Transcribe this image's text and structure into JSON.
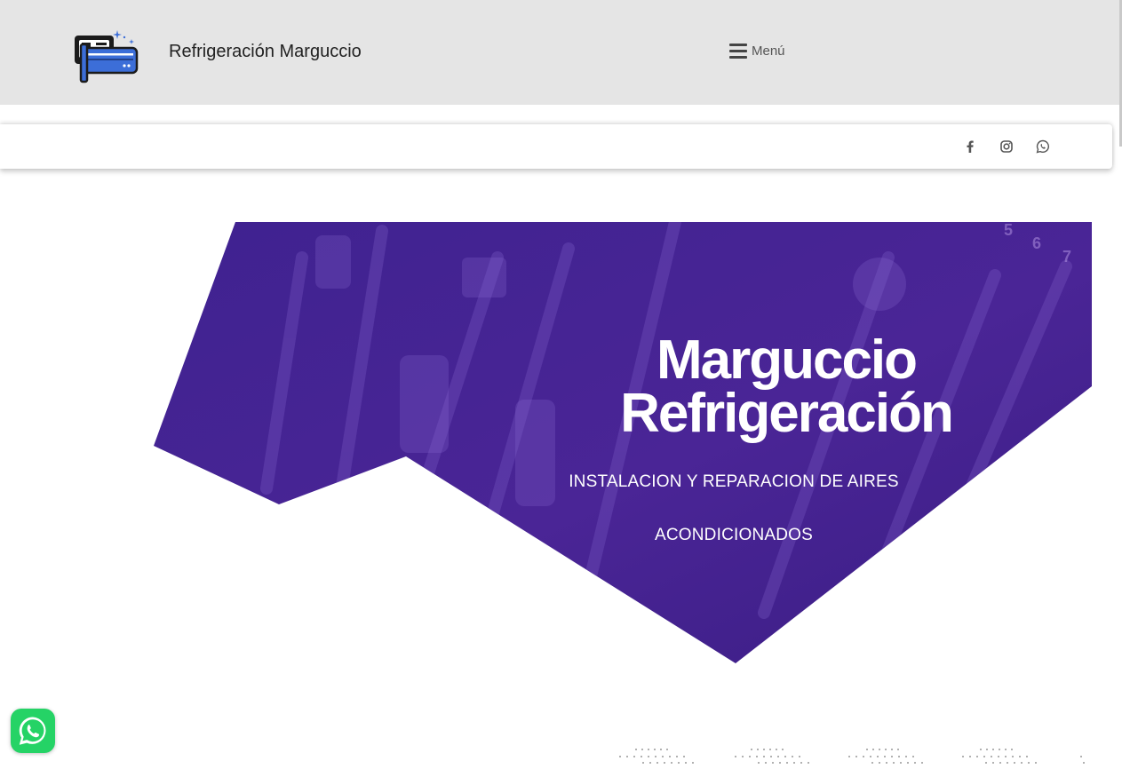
{
  "header": {
    "site_title": "Refrigeración Marguccio",
    "logo_icon": "air-conditioner-icon",
    "menu_label": "Menú",
    "menu_icon": "hamburger-icon"
  },
  "social": {
    "facebook_icon": "facebook-icon",
    "instagram_icon": "instagram-icon",
    "whatsapp_icon": "whatsapp-icon"
  },
  "hero": {
    "title_line1": "Marguccio",
    "title_line2": "Refrigeración",
    "subtitle": "INSTALACION Y REPARACION DE AIRES ACONDICIONADOS"
  },
  "floating": {
    "whatsapp_icon": "whatsapp-icon"
  },
  "colors": {
    "header_bg": "#e5e5e5",
    "hero_purple": "#4a2596",
    "whatsapp_green": "#25d366"
  }
}
